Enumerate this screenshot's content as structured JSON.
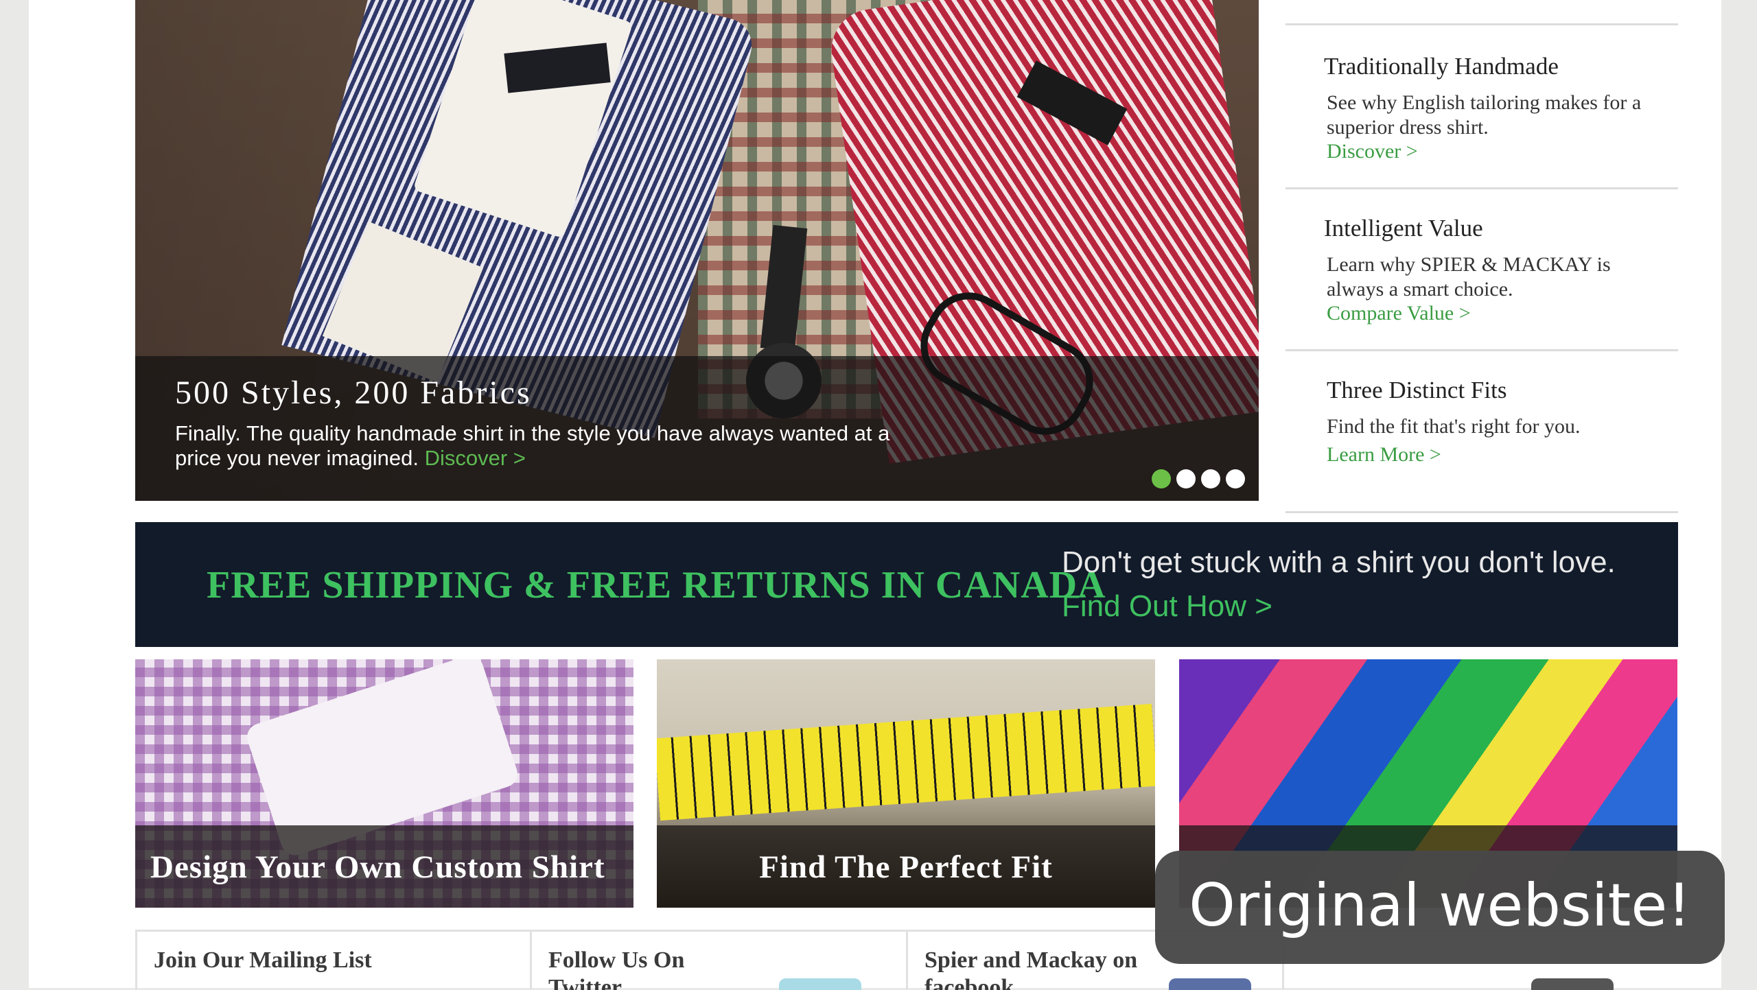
{
  "hero": {
    "title": "500 Styles, 200 Fabrics",
    "description": "Finally. The quality handmade shirt in the style you have always wanted at a price you never imagined.",
    "link": "Discover >",
    "slide_count": 4,
    "active_slide": 1
  },
  "sidebar": {
    "items": [
      {
        "title": "Traditionally Handmade",
        "text": "See why English tailoring makes for a superior dress shirt.",
        "link": "Discover >"
      },
      {
        "title": "Intelligent Value",
        "text": "Learn why SPIER & MACKAY is always a smart choice.",
        "link": "Compare Value >"
      },
      {
        "title": "Three Distinct Fits",
        "text": "Find the fit that's right for you.",
        "link": "Learn More >"
      }
    ]
  },
  "banner": {
    "headline": "FREE SHIPPING & FREE RETURNS IN CANADA",
    "subtext": "Don't get stuck with a shirt you don't love.",
    "link": "Find Out How >"
  },
  "tiles": [
    {
      "label": "Design Your Own Custom Shirt"
    },
    {
      "label": "Find The Perfect Fit"
    },
    {
      "label": ""
    }
  ],
  "footer": {
    "columns": [
      {
        "title": "Join Our Mailing List"
      },
      {
        "title": "Follow Us On Twitter"
      },
      {
        "title": "Spier and Mackay on facebook"
      },
      {
        "title": ""
      }
    ]
  },
  "overlay": {
    "text": "Original website!"
  },
  "colors": {
    "accent_green": "#3ec160",
    "banner_bg": "#121b2a",
    "link_green": "#3a9c42"
  }
}
